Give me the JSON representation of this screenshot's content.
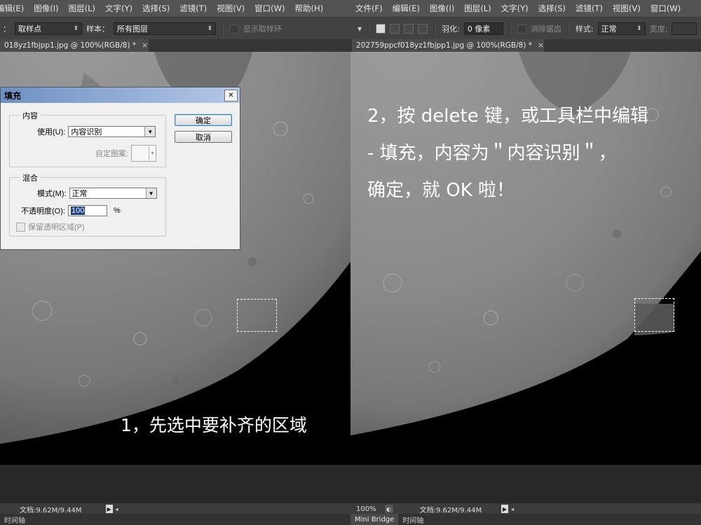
{
  "left": {
    "menu": [
      "编辑(E)",
      "图像(I)",
      "图层(L)",
      "文字(Y)",
      "选择(S)",
      "滤镜(T)",
      "视图(V)",
      "窗口(W)",
      "帮助(H)"
    ],
    "options": {
      "sample_size_label": "：",
      "sample_size_value": "取样点",
      "sample_label": "样本：",
      "sample_value": "所有图层",
      "show_ring_label": "显示取样环"
    },
    "tab": {
      "title": "018yz1fbjpp1.jpg @ 100%(RGB/8) *",
      "close": "×"
    },
    "annotation": "1，先选中要补齐的区域",
    "status": {
      "doc": "文档:9.62M/9.44M"
    },
    "panel_tab": "时间轴"
  },
  "dialog": {
    "title": "填充",
    "close": "✕",
    "content_group": "内容",
    "use_label": "使用(U):",
    "use_value": "内容识别",
    "pattern_label": "自定图案:",
    "blend_group": "混合",
    "mode_label": "模式(M):",
    "mode_value": "正常",
    "opacity_label": "不透明度(O):",
    "opacity_value": "100",
    "opacity_unit": "%",
    "preserve_label": "保留透明区域(P)",
    "ok": "确定",
    "cancel": "取消"
  },
  "right": {
    "menu": [
      "文件(F)",
      "编辑(E)",
      "图像(I)",
      "图层(L)",
      "文字(Y)",
      "选择(S)",
      "滤镜(T)",
      "视图(V)",
      "窗口(W)"
    ],
    "options": {
      "feather_label": "羽化:",
      "feather_value": "0 像素",
      "antialias_label": "消除锯齿",
      "style_label": "样式:",
      "style_value": "正常",
      "width_label": "宽度:"
    },
    "tab": {
      "title": "202759ppcf018yz1fbjpp1.jpg @ 100%(RGB/8) *",
      "close": "×"
    },
    "annotation": [
      "2，按 delete 键，或工具栏中编辑",
      "- 填充，内容为＂内容识别＂，",
      "确定，就 OK 啦！"
    ],
    "status": {
      "zoom": "100%",
      "doc": "文档:9.62M/9.44M"
    },
    "panel_tabs": [
      "Mini Bridge",
      "时间轴"
    ]
  },
  "colors": {
    "ui_dark": "#535353",
    "canvas": "#000000",
    "dialog_title": "#6e8fc4"
  }
}
